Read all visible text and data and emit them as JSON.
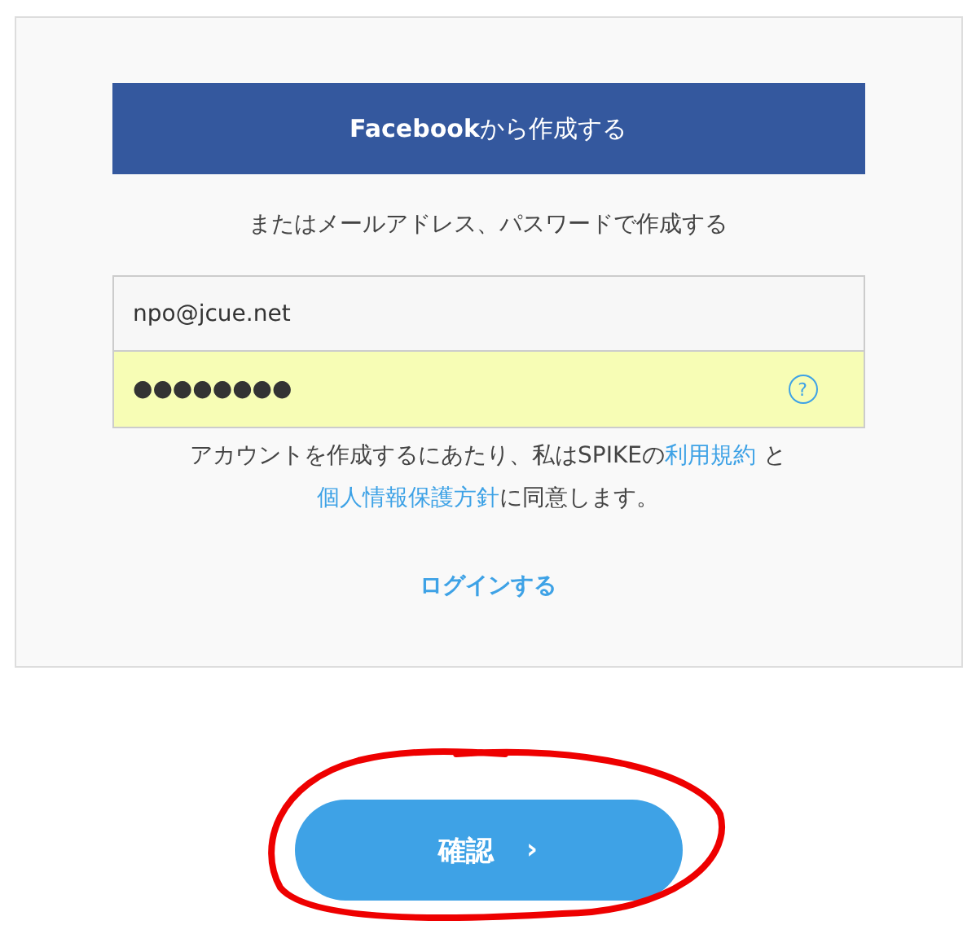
{
  "facebook_button": "**Facebook**から作成する",
  "divider_text": "またはメールアドレス、パスワードで作成する",
  "email_field": {
    "value": "npo@jcue.net"
  },
  "password_field": {
    "value": "●●●●●●●●",
    "autofilled": true,
    "help_icon": "?"
  },
  "terms": [
    {
      "kind": "text",
      "text": "アカウントを作成するにあたり、私はSPIKEの"
    },
    {
      "kind": "link",
      "text": "利用規約"
    },
    {
      "kind": "text",
      "text": " と "
    },
    {
      "kind": "link",
      "text": "個人情報保護方針"
    },
    {
      "kind": "text",
      "text": "に同意します。"
    }
  ],
  "login_link": "ログインする",
  "confirm_button": {
    "label": "確認",
    "arrow": "›"
  }
}
